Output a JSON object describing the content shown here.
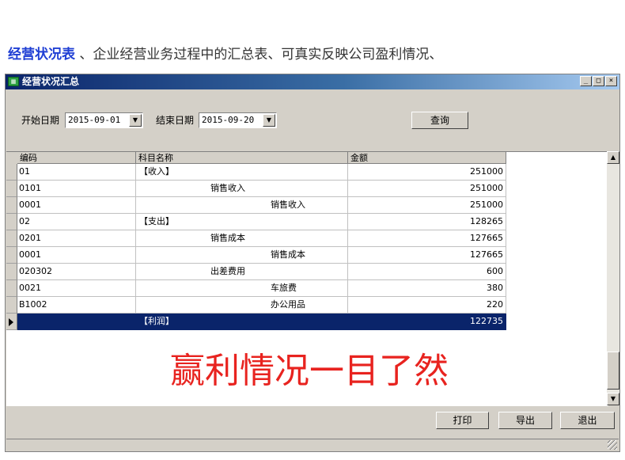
{
  "heading": {
    "highlight": "经营状况表",
    "text": " 、企业经营业务过程中的汇总表、可真实反映公司盈利情况、"
  },
  "window": {
    "title": "经营状况汇总",
    "icon": "grid-app-icon",
    "minimize": "_",
    "maximize": "□",
    "close": "×"
  },
  "filters": {
    "start_label": "开始日期",
    "start_value": "2015-09-01",
    "end_label": "结束日期",
    "end_value": "2015-09-20",
    "query_label": "查询"
  },
  "table": {
    "columns": [
      "编码",
      "科目名称",
      "金额"
    ],
    "rows": [
      {
        "code": "01",
        "name": "【收入】",
        "indent": 0,
        "amount": "251000"
      },
      {
        "code": "0101",
        "name": "销售收入",
        "indent": 1,
        "amount": "251000"
      },
      {
        "code": "0001",
        "name": "销售收入",
        "indent": 2,
        "amount": "251000"
      },
      {
        "code": "02",
        "name": "【支出】",
        "indent": 0,
        "amount": "128265"
      },
      {
        "code": "0201",
        "name": "销售成本",
        "indent": 1,
        "amount": "127665"
      },
      {
        "code": "0001",
        "name": "销售成本",
        "indent": 2,
        "amount": "127665"
      },
      {
        "code": "020302",
        "name": "出差费用",
        "indent": 1,
        "amount": "600"
      },
      {
        "code": "0021",
        "name": "车旅费",
        "indent": 2,
        "amount": "380"
      },
      {
        "code": "B1002",
        "name": "办公用品",
        "indent": 2,
        "amount": "220"
      },
      {
        "code": "",
        "name": "【利润】",
        "indent": 0,
        "amount": "122735",
        "selected": true
      }
    ]
  },
  "overlay_text": "赢利情况一目了然",
  "footer": {
    "print_label": "打印",
    "export_label": "导出",
    "exit_label": "退出"
  },
  "colors": {
    "title_bar": "#0a246a",
    "selected_row": "#0a246a",
    "overlay": "#e8231f",
    "heading_highlight": "#1f3fd4"
  }
}
